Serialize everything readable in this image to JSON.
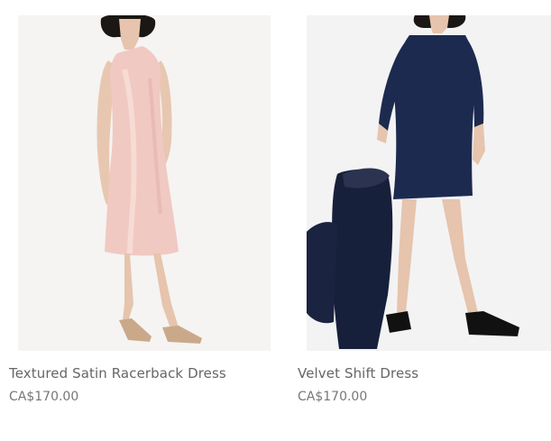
{
  "products": [
    {
      "name": "Textured Satin Racerback Dress",
      "price": "CA$170.00",
      "image": "pink-satin-racerback-dress-photo"
    },
    {
      "name": "Velvet Shift Dress",
      "price": "CA$170.00",
      "image": "navy-velvet-shift-dress-photo"
    }
  ]
}
